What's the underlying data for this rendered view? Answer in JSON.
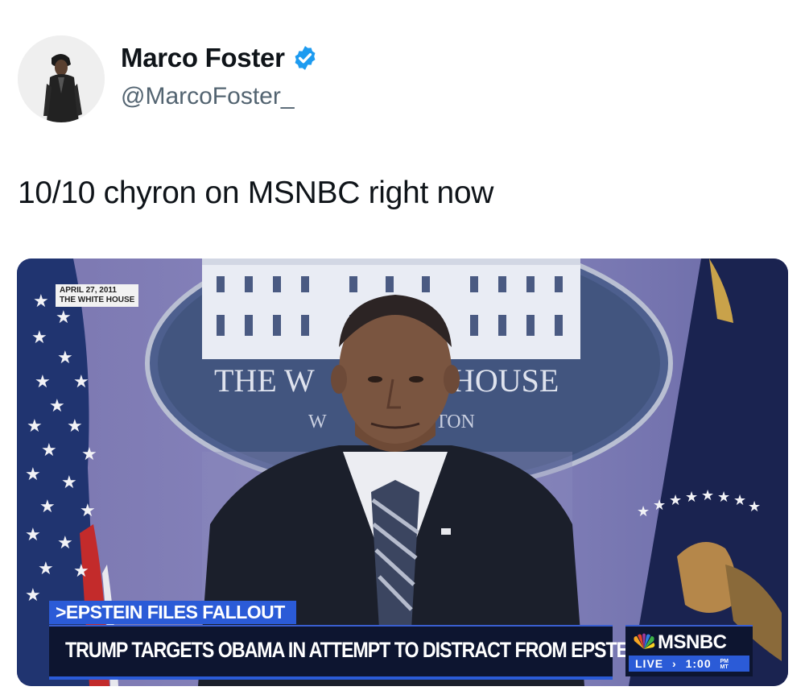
{
  "author": {
    "display_name": "Marco Foster",
    "handle": "@MarcoFoster_",
    "verified": true
  },
  "tweet": {
    "text": "10/10 chyron on MSNBC right now"
  },
  "media": {
    "dateline": [
      "APRIL 27, 2011",
      "THE WHITE HOUSE"
    ],
    "backdrop_text": [
      "THE W",
      "HOUSE",
      "W",
      "TON"
    ],
    "chyron": {
      "topic": ">EPSTEIN FILES FALLOUT",
      "headline": "TRUMP TARGETS OBAMA IN ATTEMPT TO DISTRACT FROM EPSTEIN"
    },
    "network": {
      "name": "MSNBC",
      "live_label": "LIVE",
      "arrow": "›",
      "time": "1:00",
      "ampm": [
        "PM",
        "MT"
      ]
    }
  },
  "colors": {
    "verified_badge": "#1d9bf0",
    "chyron_blue": "#2b5bd7",
    "chyron_navy": "#0d1530"
  }
}
